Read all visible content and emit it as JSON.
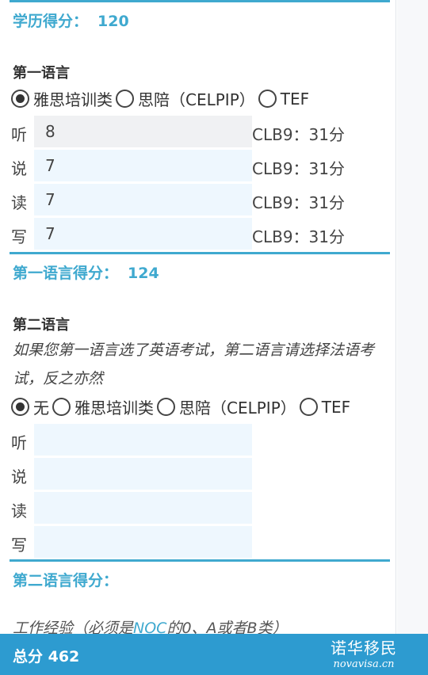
{
  "education": {
    "label": "学历得分：",
    "value": "120"
  },
  "first_language": {
    "title": "第一语言",
    "options": [
      {
        "label": "雅思培训类",
        "selected": true
      },
      {
        "label": "思陪（CELPIP）",
        "selected": false
      },
      {
        "label": "TEF",
        "selected": false
      }
    ],
    "rows": [
      {
        "label": "听",
        "value": "8",
        "clb": "CLB9：31分"
      },
      {
        "label": "说",
        "value": "7",
        "clb": "CLB9：31分"
      },
      {
        "label": "读",
        "value": "7",
        "clb": "CLB9：31分"
      },
      {
        "label": "写",
        "value": "7",
        "clb": "CLB9：31分"
      }
    ],
    "score_label": "第一语言得分：",
    "score_value": "124"
  },
  "second_language": {
    "title": "第二语言",
    "note": "如果您第一语言选了英语考试，第二语言请选择法语考试，反之亦然",
    "options": [
      {
        "label": "无",
        "selected": true
      },
      {
        "label": "雅思培训类",
        "selected": false
      },
      {
        "label": "思陪（CELPIP）",
        "selected": false
      },
      {
        "label": "TEF",
        "selected": false
      }
    ],
    "rows": [
      {
        "label": "听",
        "value": ""
      },
      {
        "label": "说",
        "value": ""
      },
      {
        "label": "读",
        "value": ""
      },
      {
        "label": "写",
        "value": ""
      }
    ],
    "score_label": "第二语言得分："
  },
  "work": {
    "prefix": "工作经验（必须是",
    "noc": "NOC",
    "suffix": "的0、A或者B类）"
  },
  "footer": {
    "total": "总分 462",
    "logo_cn": "诺华移民",
    "logo_en": "novavisa.cn"
  },
  "colors": {
    "accent": "#3fa9cf",
    "footer_bg": "#2d9bd0",
    "input_bg": "#eef7fe"
  }
}
